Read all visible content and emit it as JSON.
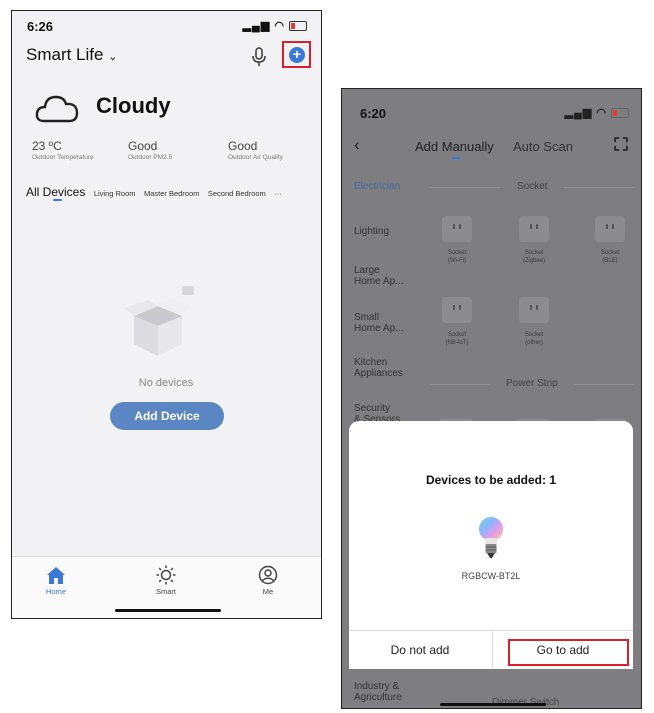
{
  "screen1": {
    "status_time": "6:26",
    "home_title": "Smart Life",
    "weather": "Cloudy",
    "stats": [
      {
        "value": "23 ºC",
        "label": "Outdoor Temperature"
      },
      {
        "value": "Good",
        "label": "Outdoor PM2.5"
      },
      {
        "value": "Good",
        "label": "Outdoor Air Quality"
      }
    ],
    "tabs": [
      "All Devices",
      "Living Room",
      "Master Bedroom",
      "Second Bedroom",
      "···"
    ],
    "empty_text": "No devices",
    "add_device_label": "Add Device",
    "tabbar": [
      {
        "label": "Home"
      },
      {
        "label": "Smart"
      },
      {
        "label": "Me"
      }
    ],
    "accent_color": "#3c78d8",
    "highlight_color": "#d6202a"
  },
  "screen2": {
    "status_time": "6:20",
    "tab_manual": "Add Manually",
    "tab_auto": "Auto Scan",
    "categories": [
      "Electrician",
      "Lighting",
      "Large\nHome Ap...",
      "Small\nHome Ap...",
      "Kitchen\nAppliances",
      "Security\n& Sensors",
      "Industry &\nAgriculture"
    ],
    "section_socket": "Socket",
    "section_power_strip": "Power Strip",
    "section_dimmer": "Dimmer Switch",
    "sockets": [
      {
        "name": "Socket",
        "sub": "(Wi-Fi)"
      },
      {
        "name": "Socket",
        "sub": "(Zigbee)"
      },
      {
        "name": "Socket",
        "sub": "(BLE)"
      },
      {
        "name": "Socket",
        "sub": "(NB-IoT)"
      },
      {
        "name": "Socket",
        "sub": "(other)"
      }
    ],
    "dialog": {
      "title": "Devices to be added: 1",
      "device_name": "RGBCW-BT2L",
      "cancel_label": "Do not add",
      "confirm_label": "Go to add"
    }
  }
}
